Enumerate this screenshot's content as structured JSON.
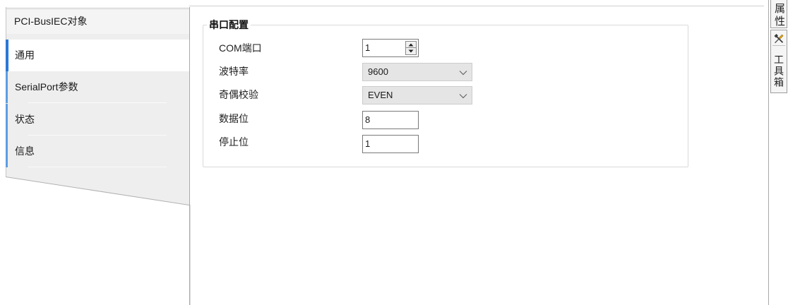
{
  "left_tabs": {
    "header": "PCI-BusIEC对象",
    "items": [
      {
        "label": "通用",
        "selected": true
      },
      {
        "label": "SerialPort参数",
        "selected": false
      },
      {
        "label": "状态",
        "selected": false
      },
      {
        "label": "信息",
        "selected": false
      }
    ]
  },
  "serial_config": {
    "title": "串口配置",
    "com_port": {
      "label": "COM端口",
      "value": "1"
    },
    "baud_rate": {
      "label": "波特率",
      "value": "9600"
    },
    "parity": {
      "label": "奇偶校验",
      "value": "EVEN"
    },
    "data_bits": {
      "label": "数据位",
      "value": "8"
    },
    "stop_bits": {
      "label": "停止位",
      "value": "1"
    }
  },
  "side_tabs": {
    "properties_label": "属性",
    "toolbox_label": "工具箱"
  },
  "icons": {
    "spin_up": "spin-up-icon",
    "spin_down": "spin-down-icon",
    "dropdown": "chevron-down-icon",
    "toolbox": "toolbox-icon"
  },
  "colors": {
    "accent": "#2a78d6",
    "accent_light": "#5d9de3",
    "panel_bg": "#eeeeee",
    "select_bg": "#e5e5e5"
  }
}
